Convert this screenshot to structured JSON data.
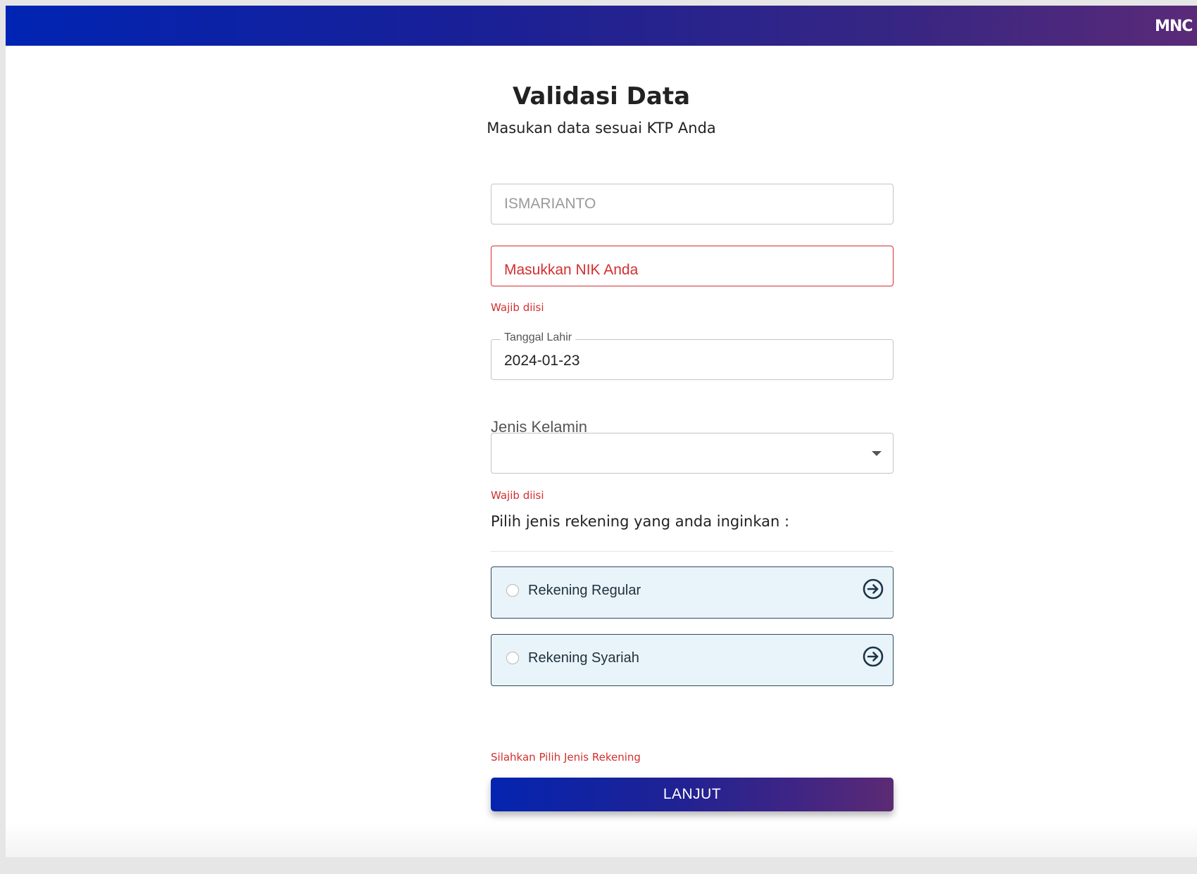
{
  "header": {
    "logo_text": "MNC",
    "gradient_start": "#0024b3",
    "gradient_end": "#5a2a78"
  },
  "page": {
    "title": "Validasi Data",
    "subtitle": "Masukan data sesuai KTP Anda"
  },
  "form": {
    "name": {
      "value": "",
      "placeholder": "ISMARIANTO"
    },
    "nik": {
      "value": "",
      "placeholder": "Masukkan NIK Anda",
      "error": "Wajib diisi"
    },
    "birthdate": {
      "label": "Tanggal Lahir",
      "value": "2024-01-23"
    },
    "gender": {
      "label": "Jenis Kelamin",
      "value": "",
      "error": "Wajib diisi"
    },
    "account_section_label": "Pilih jenis rekening yang anda inginkan :",
    "account_options": [
      {
        "label": "Rekening Regular",
        "selected": false,
        "icon": "arrow-right-circle-icon"
      },
      {
        "label": "Rekening Syariah",
        "selected": false,
        "icon": "arrow-right-circle-icon"
      }
    ],
    "account_error": "Silahkan Pilih Jenis Rekening",
    "submit_label": "LANJUT"
  },
  "colors": {
    "error": "#d32f2f",
    "option_bg": "#e8f4fa",
    "option_border": "#2f4a5c"
  }
}
